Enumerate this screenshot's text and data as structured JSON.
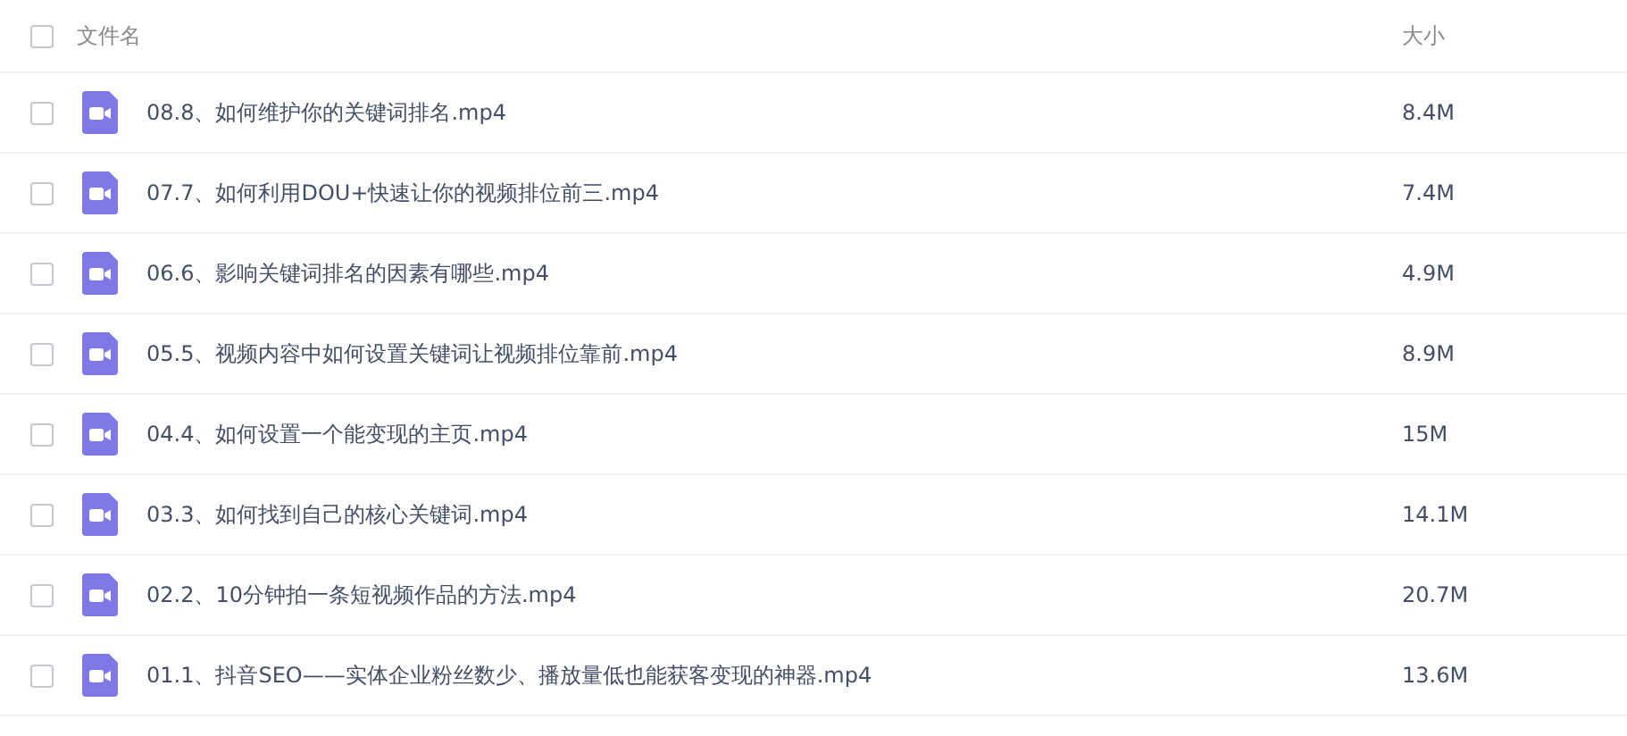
{
  "header": {
    "select_all_checked": false,
    "name_label": "文件名",
    "size_label": "大小"
  },
  "files": [
    {
      "name": "08.8、如何维护你的关键词排名.mp4",
      "size": "8.4M",
      "checked": false
    },
    {
      "name": "07.7、如何利用DOU+快速让你的视频排位前三.mp4",
      "size": "7.4M",
      "checked": false
    },
    {
      "name": "06.6、影响关键词排名的因素有哪些.mp4",
      "size": "4.9M",
      "checked": false
    },
    {
      "name": "05.5、视频内容中如何设置关键词让视频排位靠前.mp4",
      "size": "8.9M",
      "checked": false
    },
    {
      "name": "04.4、如何设置一个能变现的主页.mp4",
      "size": "15M",
      "checked": false
    },
    {
      "name": "03.3、如何找到自己的核心关键词.mp4",
      "size": "14.1M",
      "checked": false
    },
    {
      "name": "02.2、10分钟拍一条短视频作品的方法.mp4",
      "size": "20.7M",
      "checked": false
    },
    {
      "name": "01.1、抖音SEO——实体企业粉丝数少、播放量低也能获客变现的神器.mp4",
      "size": "13.6M",
      "checked": false
    }
  ]
}
